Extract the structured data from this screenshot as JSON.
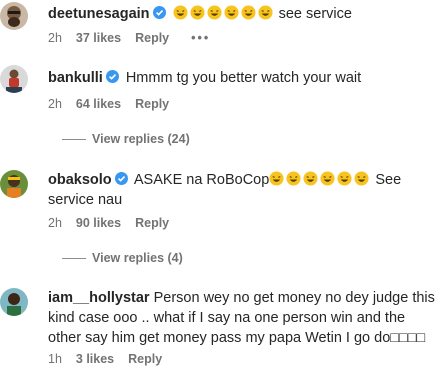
{
  "comments": [
    {
      "username": "deetunesagain",
      "text": "see service",
      "time": "2h",
      "likes": "37 likes",
      "reply": "Reply",
      "more": "•••"
    },
    {
      "username": "bankulli",
      "text": "Hmmm tg you better watch your wait",
      "time": "2h",
      "likes": "64 likes",
      "reply": "Reply",
      "view_replies": "View replies (24)"
    },
    {
      "username": "obaksolo",
      "text_before": "ASAKE na RoBoCop",
      "text_after": "See service nau",
      "time": "2h",
      "likes": "90 likes",
      "reply": "Reply",
      "view_replies": "View replies (4)"
    },
    {
      "username": "iam__hollystar",
      "text": "Person wey no get money no dey judge this kind case ooo .. what if I say na one person win and the other say him get money pass my papa Wetin I go do□□□□",
      "time": "1h",
      "likes": "3 likes",
      "reply": "Reply"
    }
  ],
  "colors": {
    "verified": "#3897f0",
    "meta": "#737373",
    "emoji": "#f7c31e"
  },
  "icons": {
    "verified": "verified-badge-icon",
    "emoji": "laughing-emoji-icon"
  }
}
